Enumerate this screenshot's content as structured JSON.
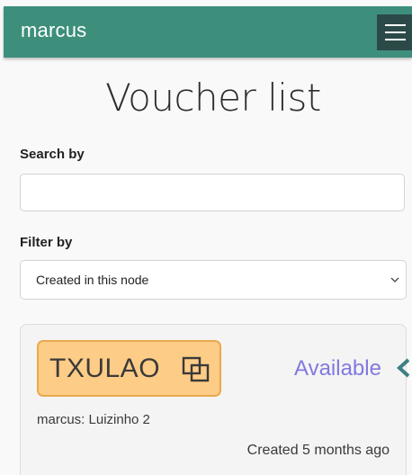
{
  "header": {
    "brand": "marcus",
    "menu_icon": "hamburger-menu-icon",
    "color": "#3d8f7c"
  },
  "page": {
    "title": "Voucher list"
  },
  "search": {
    "label": "Search by",
    "value": "",
    "placeholder": ""
  },
  "filter": {
    "label": "Filter by",
    "selected": "Created in this node"
  },
  "vouchers": [
    {
      "code": "TXULAO",
      "copy_icon": "copy-icon",
      "status": "Available",
      "status_color": "#8179df",
      "owner": "marcus: Luizinho 2",
      "created": "Created 5 months ago",
      "chip_color": "#fdcc86"
    }
  ]
}
